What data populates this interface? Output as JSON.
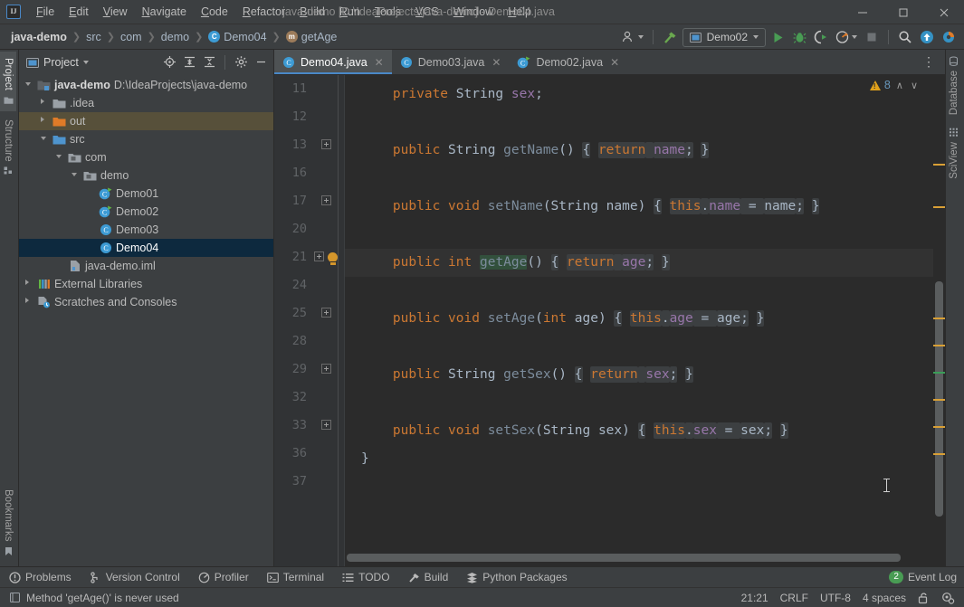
{
  "window": {
    "title": "java-demo [D:\\IdeaProjects\\java-demo] - Demo04.java",
    "logo": "IJ",
    "minimize": "—",
    "maximize": "☐",
    "close": "✕"
  },
  "menu": [
    {
      "label": "File",
      "icon": "menu-file"
    },
    {
      "label": "Edit",
      "icon": "menu-edit"
    },
    {
      "label": "View",
      "icon": "menu-view"
    },
    {
      "label": "Navigate",
      "icon": "menu-navigate"
    },
    {
      "label": "Code",
      "icon": "menu-code"
    },
    {
      "label": "Refactor",
      "icon": "menu-refactor"
    },
    {
      "label": "Build",
      "icon": "menu-build"
    },
    {
      "label": "Run",
      "icon": "menu-run"
    },
    {
      "label": "Tools",
      "icon": "menu-tools"
    },
    {
      "label": "VCS",
      "icon": "menu-vcs"
    },
    {
      "label": "Window",
      "icon": "menu-window"
    },
    {
      "label": "Help",
      "icon": "menu-help"
    }
  ],
  "breadcrumb": [
    {
      "label": "java-demo",
      "icon": null
    },
    {
      "label": "src",
      "icon": null
    },
    {
      "label": "com",
      "icon": null
    },
    {
      "label": "demo",
      "icon": null
    },
    {
      "label": "Demo04",
      "icon": "class-icon",
      "glyph": "C"
    },
    {
      "label": "getAge",
      "icon": "method-icon",
      "glyph": "m"
    }
  ],
  "breadcrumb_separator": "❯",
  "toolbar": {
    "account_icon": "user-icon",
    "build_icon": "hammer-icon",
    "run_config": "Demo02",
    "run_icon": "run-icon",
    "debug_icon": "debug-icon",
    "run_coverage_icon": "coverage-icon",
    "profiler_icon": "profiler-icon",
    "stop_icon": "stop-icon",
    "search_icon": "search-icon",
    "update_icon": "update-icon",
    "plugin_icon": "plugin-icon"
  },
  "rail_left": [
    {
      "label": "Project",
      "icon": "project-icon",
      "active": true
    },
    {
      "label": "Structure",
      "icon": "structure-icon",
      "active": false
    },
    {
      "label": "Bookmarks",
      "icon": "bookmarks-icon",
      "active": false
    }
  ],
  "rail_right": [
    {
      "label": "Database",
      "icon": "database-icon"
    },
    {
      "label": "SciView",
      "icon": "sciview-icon"
    }
  ],
  "project_panel": {
    "title": "Project",
    "tools": [
      "locate-icon",
      "expand-all-icon",
      "collapse-all-icon",
      "settings-icon",
      "minimize-icon"
    ],
    "tree": [
      {
        "label": "java-demo",
        "path": "D:\\IdeaProjects\\java-demo",
        "indent": 0,
        "arrow": "down",
        "icon": "module-folder",
        "state": "normal",
        "bold": true
      },
      {
        "label": ".idea",
        "path": "",
        "indent": 1,
        "arrow": "right",
        "icon": "folder-grey",
        "state": "normal",
        "bold": false
      },
      {
        "label": "out",
        "path": "",
        "indent": 1,
        "arrow": "right",
        "icon": "folder-orange",
        "state": "highlight",
        "bold": false
      },
      {
        "label": "src",
        "path": "",
        "indent": 1,
        "arrow": "down",
        "icon": "folder-blue",
        "state": "normal",
        "bold": false
      },
      {
        "label": "com",
        "path": "",
        "indent": 2,
        "arrow": "down",
        "icon": "package",
        "state": "normal",
        "bold": false
      },
      {
        "label": "demo",
        "path": "",
        "indent": 3,
        "arrow": "down",
        "icon": "package",
        "state": "normal",
        "bold": false
      },
      {
        "label": "Demo01",
        "path": "",
        "indent": 4,
        "arrow": "none",
        "icon": "class-runnable",
        "state": "normal",
        "bold": false
      },
      {
        "label": "Demo02",
        "path": "",
        "indent": 4,
        "arrow": "none",
        "icon": "class-runnable",
        "state": "normal",
        "bold": false
      },
      {
        "label": "Demo03",
        "path": "",
        "indent": 4,
        "arrow": "none",
        "icon": "class",
        "state": "normal",
        "bold": false
      },
      {
        "label": "Demo04",
        "path": "",
        "indent": 4,
        "arrow": "none",
        "icon": "class",
        "state": "selected",
        "bold": false
      },
      {
        "label": "java-demo.iml",
        "path": "",
        "indent": 2,
        "arrow": "none",
        "icon": "iml",
        "state": "normal",
        "bold": false
      },
      {
        "label": "External Libraries",
        "path": "",
        "indent": 0,
        "arrow": "right",
        "icon": "libraries",
        "state": "normal",
        "bold": false
      },
      {
        "label": "Scratches and Consoles",
        "path": "",
        "indent": 0,
        "arrow": "right",
        "icon": "scratches",
        "state": "normal",
        "bold": false
      }
    ]
  },
  "editor": {
    "tabs": [
      {
        "label": "Demo04.java",
        "icon": "class-icon",
        "active": true,
        "close": "✕"
      },
      {
        "label": "Demo03.java",
        "icon": "class-icon",
        "active": false,
        "close": "✕"
      },
      {
        "label": "Demo02.java",
        "icon": "class-runnable-icon",
        "active": false,
        "close": "✕"
      }
    ],
    "more_icon": "⋮",
    "warning_count": "8",
    "warning_icon": "warning-icon",
    "prev_icon": "∧",
    "next_icon": "∨",
    "lines": [
      {
        "num": "11",
        "fold": false,
        "bulb": false,
        "current": false,
        "tokens": [
          {
            "t": "    ",
            "c": "pun"
          },
          {
            "t": "private",
            "c": "kw"
          },
          {
            "t": " ",
            "c": "pun"
          },
          {
            "t": "String",
            "c": "typ"
          },
          {
            "t": " ",
            "c": "pun"
          },
          {
            "t": "sex",
            "c": "fld2"
          },
          {
            "t": ";",
            "c": "pun"
          }
        ]
      },
      {
        "num": "12",
        "fold": false,
        "bulb": false,
        "current": false,
        "tokens": []
      },
      {
        "num": "13",
        "fold": true,
        "bulb": false,
        "current": false,
        "tokens": [
          {
            "t": "    ",
            "c": "pun"
          },
          {
            "t": "public",
            "c": "kw"
          },
          {
            "t": " ",
            "c": "pun"
          },
          {
            "t": "String",
            "c": "typ"
          },
          {
            "t": " ",
            "c": "pun"
          },
          {
            "t": "getName",
            "c": "mth"
          },
          {
            "t": "()",
            "c": "pun"
          },
          {
            "t": " ",
            "c": "pun"
          },
          {
            "t": "{",
            "c": "pun",
            "fold": true
          },
          {
            "t": " ",
            "c": "pun"
          },
          {
            "t": "return",
            "c": "kw",
            "fold": true
          },
          {
            "t": " ",
            "c": "pun",
            "fold": true
          },
          {
            "t": "name",
            "c": "fld2",
            "fold": true
          },
          {
            "t": ";",
            "c": "pun",
            "fold": true
          },
          {
            "t": " ",
            "c": "pun"
          },
          {
            "t": "}",
            "c": "pun",
            "fold": true
          }
        ]
      },
      {
        "num": "16",
        "fold": false,
        "bulb": false,
        "current": false,
        "tokens": []
      },
      {
        "num": "17",
        "fold": true,
        "bulb": false,
        "current": false,
        "tokens": [
          {
            "t": "    ",
            "c": "pun"
          },
          {
            "t": "public",
            "c": "kw"
          },
          {
            "t": " ",
            "c": "pun"
          },
          {
            "t": "void",
            "c": "kw"
          },
          {
            "t": " ",
            "c": "pun"
          },
          {
            "t": "setName",
            "c": "mth"
          },
          {
            "t": "(",
            "c": "pun"
          },
          {
            "t": "String",
            "c": "typ"
          },
          {
            "t": " ",
            "c": "pun"
          },
          {
            "t": "name",
            "c": "pun"
          },
          {
            "t": ")",
            "c": "pun"
          },
          {
            "t": " ",
            "c": "pun"
          },
          {
            "t": "{",
            "c": "pun",
            "fold": true
          },
          {
            "t": " ",
            "c": "pun"
          },
          {
            "t": "this",
            "c": "kw",
            "fold": true
          },
          {
            "t": ".",
            "c": "pun",
            "fold": true
          },
          {
            "t": "name",
            "c": "fld2",
            "fold": true
          },
          {
            "t": " = ",
            "c": "pun",
            "fold": true
          },
          {
            "t": "name",
            "c": "pun",
            "fold": true
          },
          {
            "t": ";",
            "c": "pun",
            "fold": true
          },
          {
            "t": " ",
            "c": "pun"
          },
          {
            "t": "}",
            "c": "pun",
            "fold": true
          }
        ]
      },
      {
        "num": "20",
        "fold": false,
        "bulb": false,
        "current": false,
        "tokens": []
      },
      {
        "num": "21",
        "fold": true,
        "bulb": true,
        "current": true,
        "tokens": [
          {
            "t": "    ",
            "c": "pun"
          },
          {
            "t": "public",
            "c": "kw"
          },
          {
            "t": " ",
            "c": "pun"
          },
          {
            "t": "int",
            "c": "kw"
          },
          {
            "t": " ",
            "c": "pun"
          },
          {
            "t": "getAge",
            "c": "mth",
            "usage": true
          },
          {
            "t": "()",
            "c": "pun"
          },
          {
            "t": " ",
            "c": "pun"
          },
          {
            "t": "{",
            "c": "pun",
            "fold": true
          },
          {
            "t": " ",
            "c": "pun"
          },
          {
            "t": "return",
            "c": "kw",
            "fold": true
          },
          {
            "t": " ",
            "c": "pun",
            "fold": true
          },
          {
            "t": "age",
            "c": "fld2",
            "fold": true
          },
          {
            "t": ";",
            "c": "pun",
            "fold": true
          },
          {
            "t": " ",
            "c": "pun"
          },
          {
            "t": "}",
            "c": "pun",
            "fold": true
          }
        ]
      },
      {
        "num": "24",
        "fold": false,
        "bulb": false,
        "current": false,
        "tokens": []
      },
      {
        "num": "25",
        "fold": true,
        "bulb": false,
        "current": false,
        "tokens": [
          {
            "t": "    ",
            "c": "pun"
          },
          {
            "t": "public",
            "c": "kw"
          },
          {
            "t": " ",
            "c": "pun"
          },
          {
            "t": "void",
            "c": "kw"
          },
          {
            "t": " ",
            "c": "pun"
          },
          {
            "t": "setAge",
            "c": "mth"
          },
          {
            "t": "(",
            "c": "pun"
          },
          {
            "t": "int",
            "c": "kw"
          },
          {
            "t": " ",
            "c": "pun"
          },
          {
            "t": "age",
            "c": "pun"
          },
          {
            "t": ")",
            "c": "pun"
          },
          {
            "t": " ",
            "c": "pun"
          },
          {
            "t": "{",
            "c": "pun",
            "fold": true
          },
          {
            "t": " ",
            "c": "pun"
          },
          {
            "t": "this",
            "c": "kw",
            "fold": true
          },
          {
            "t": ".",
            "c": "pun",
            "fold": true
          },
          {
            "t": "age",
            "c": "fld2",
            "fold": true
          },
          {
            "t": " = ",
            "c": "pun",
            "fold": true
          },
          {
            "t": "age",
            "c": "pun",
            "fold": true
          },
          {
            "t": ";",
            "c": "pun",
            "fold": true
          },
          {
            "t": " ",
            "c": "pun"
          },
          {
            "t": "}",
            "c": "pun",
            "fold": true
          }
        ]
      },
      {
        "num": "28",
        "fold": false,
        "bulb": false,
        "current": false,
        "tokens": []
      },
      {
        "num": "29",
        "fold": true,
        "bulb": false,
        "current": false,
        "tokens": [
          {
            "t": "    ",
            "c": "pun"
          },
          {
            "t": "public",
            "c": "kw"
          },
          {
            "t": " ",
            "c": "pun"
          },
          {
            "t": "String",
            "c": "typ"
          },
          {
            "t": " ",
            "c": "pun"
          },
          {
            "t": "getSex",
            "c": "mth"
          },
          {
            "t": "()",
            "c": "pun"
          },
          {
            "t": " ",
            "c": "pun"
          },
          {
            "t": "{",
            "c": "pun",
            "fold": true
          },
          {
            "t": " ",
            "c": "pun"
          },
          {
            "t": "return",
            "c": "kw",
            "fold": true
          },
          {
            "t": " ",
            "c": "pun",
            "fold": true
          },
          {
            "t": "sex",
            "c": "fld2",
            "fold": true
          },
          {
            "t": ";",
            "c": "pun",
            "fold": true
          },
          {
            "t": " ",
            "c": "pun"
          },
          {
            "t": "}",
            "c": "pun",
            "fold": true
          }
        ]
      },
      {
        "num": "32",
        "fold": false,
        "bulb": false,
        "current": false,
        "tokens": []
      },
      {
        "num": "33",
        "fold": true,
        "bulb": false,
        "current": false,
        "tokens": [
          {
            "t": "    ",
            "c": "pun"
          },
          {
            "t": "public",
            "c": "kw"
          },
          {
            "t": " ",
            "c": "pun"
          },
          {
            "t": "void",
            "c": "kw"
          },
          {
            "t": " ",
            "c": "pun"
          },
          {
            "t": "setSex",
            "c": "mth"
          },
          {
            "t": "(",
            "c": "pun"
          },
          {
            "t": "String",
            "c": "typ"
          },
          {
            "t": " ",
            "c": "pun"
          },
          {
            "t": "sex",
            "c": "pun"
          },
          {
            "t": ")",
            "c": "pun"
          },
          {
            "t": " ",
            "c": "pun"
          },
          {
            "t": "{",
            "c": "pun",
            "fold": true
          },
          {
            "t": " ",
            "c": "pun"
          },
          {
            "t": "this",
            "c": "kw",
            "fold": true
          },
          {
            "t": ".",
            "c": "pun",
            "fold": true
          },
          {
            "t": "sex",
            "c": "fld2",
            "fold": true
          },
          {
            "t": " = ",
            "c": "pun",
            "fold": true
          },
          {
            "t": "sex",
            "c": "pun",
            "fold": true
          },
          {
            "t": ";",
            "c": "pun",
            "fold": true
          },
          {
            "t": " ",
            "c": "pun"
          },
          {
            "t": "}",
            "c": "pun",
            "fold": true
          }
        ]
      },
      {
        "num": "36",
        "fold": false,
        "bulb": false,
        "current": false,
        "tokens": [
          {
            "t": "}",
            "c": "pun"
          }
        ]
      },
      {
        "num": "37",
        "fold": false,
        "bulb": false,
        "current": false,
        "tokens": []
      }
    ]
  },
  "bottom_bar": {
    "items": [
      {
        "label": "Problems",
        "icon": "problems-icon"
      },
      {
        "label": "Version Control",
        "icon": "vcs-icon"
      },
      {
        "label": "Profiler",
        "icon": "profiler-icon"
      },
      {
        "label": "Terminal",
        "icon": "terminal-icon"
      },
      {
        "label": "TODO",
        "icon": "todo-icon"
      },
      {
        "label": "Build",
        "icon": "build-icon"
      },
      {
        "label": "Python Packages",
        "icon": "python-packages-icon"
      }
    ],
    "event_log": {
      "label": "Event Log",
      "count": "2"
    }
  },
  "status_bar": {
    "message": "Method 'getAge()' is never used",
    "message_icon": "inspection-icon",
    "caret_position": "21:21",
    "line_separator": "CRLF",
    "encoding": "UTF-8",
    "indent": "4 spaces",
    "lock_icon": "unlocked-icon",
    "config_icon": "config-icon"
  },
  "colors": {
    "accent": "#4a88c7",
    "keyword": "#cc7832",
    "field": "#9876aa",
    "method": "#7c8c9c",
    "warning": "#e0a11b",
    "green_badge": "#499c54",
    "selection": "#0d293e"
  }
}
